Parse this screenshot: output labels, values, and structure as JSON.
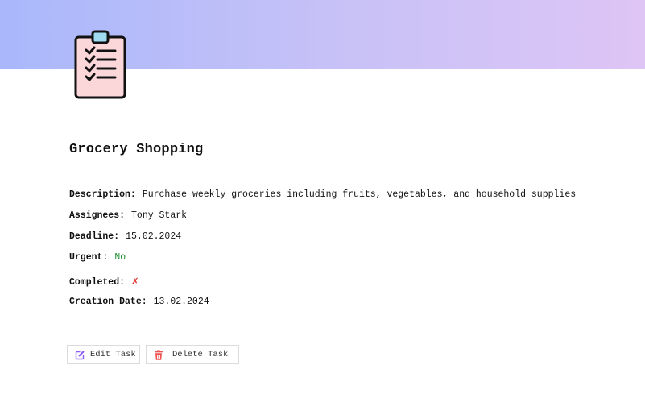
{
  "task": {
    "title": "Grocery Shopping",
    "icon": "clipboard-checklist-icon"
  },
  "fields": {
    "description": {
      "label": "Description:",
      "value": "Purchase weekly groceries including fruits, vegetables, and household supplies"
    },
    "assignees": {
      "label": "Assignees:",
      "value": "Tony Stark"
    },
    "deadline": {
      "label": "Deadline:",
      "value": "15.02.2024"
    },
    "urgent": {
      "label": "Urgent:",
      "value": "No"
    },
    "completed": {
      "label": "Completed:",
      "value": "✗"
    },
    "creation_date": {
      "label": "Creation Date:",
      "value": "13.02.2024"
    }
  },
  "actions": {
    "edit_label": "Edit Task",
    "edit_icon": "edit-icon",
    "delete_label": "Delete Task",
    "delete_icon": "trash-icon"
  },
  "colors": {
    "banner_start": "#a9b8fb",
    "banner_end": "#dec5f5",
    "urgent_no": "#1a8a2c",
    "completed_false": "#e53935",
    "edit_accent": "#8b5cf6",
    "delete_accent": "#f05252"
  }
}
